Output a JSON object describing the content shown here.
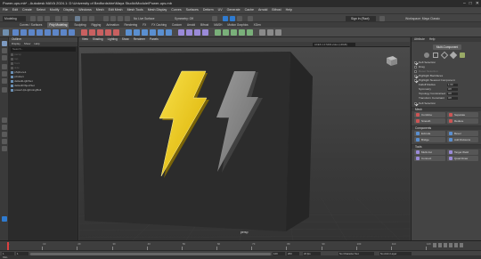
{
  "window": {
    "title": "Power-ups.mb* - Autodesk MAYA 2024.1: D:\\University of Bedfordshire\\Maya Studio\\Module\\Power-ups.mb",
    "min": "–",
    "max": "□",
    "close": "✕"
  },
  "menubar": [
    "File",
    "Edit",
    "Create",
    "Select",
    "Modify",
    "Display",
    "Windows",
    "Mesh",
    "Edit Mesh",
    "Mesh Tools",
    "Mesh Display",
    "Curves",
    "Surfaces",
    "Deform",
    "UV",
    "Generate",
    "Cache",
    "Arnold",
    "Bifrost",
    "Help"
  ],
  "statusline": {
    "workspace_menu": "Modeling",
    "symmetry": "Symmetry: Off",
    "live_surface": "No Live Surface",
    "sign_in": "Sign In (Ravi)",
    "workspace_label": "Workspace: Maya Classic"
  },
  "shelf": {
    "tabs": [
      "Curves / Surfaces",
      "Poly Modeling",
      "Sculpting",
      "Rigging",
      "Animation",
      "Rendering",
      "FX",
      "FX Caching",
      "Custom",
      "Arnold",
      "Bifrost",
      "MASH",
      "Motion Graphics",
      "XGen"
    ],
    "active": "Poly Modeling"
  },
  "outliner": {
    "title": "Outliner",
    "menus": [
      "Display",
      "Show",
      "Help"
    ],
    "search": "Search...",
    "items": [
      {
        "label": "persp",
        "visible": false
      },
      {
        "label": "top",
        "visible": false
      },
      {
        "label": "front",
        "visible": false
      },
      {
        "label": "side",
        "visible": false
      },
      {
        "label": "pSphere1",
        "visible": true
      },
      {
        "label": "pCube1",
        "visible": true
      },
      {
        "label": "defaultLightSet",
        "visible": true
      },
      {
        "label": "defaultObjectSet",
        "visible": true
      },
      {
        "label": "powerUpLightningBolt",
        "visible": true
      }
    ]
  },
  "viewport": {
    "menus": [
      "View",
      "Shading",
      "Lighting",
      "Show",
      "Renderer",
      "Panels"
    ],
    "camera_field": "ACES 1.0 SDR-video (sRGB)",
    "camera_name": "persp"
  },
  "attr": {
    "tabs": [
      "Attribute",
      "Help"
    ],
    "multi_button": "Multi-Component",
    "options": [
      {
        "label": "Soft Selection",
        "checked": true,
        "dim": false
      },
      {
        "label": "Drag",
        "checked": false,
        "dim": false
      },
      {
        "label": "Reset Selection",
        "checked": false,
        "dim": true
      },
      {
        "label": "Highlight Backfaces",
        "checked": true,
        "dim": false
      },
      {
        "label": "Highlight Nearest Component",
        "checked": true,
        "dim": false
      }
    ],
    "falloff": {
      "label": "Falloff Radius",
      "value": "1.00"
    },
    "sym": {
      "label": "Symmetry",
      "value": "Off"
    },
    "topo": {
      "label": "Topology Constrained",
      "value": "Off"
    },
    "trans": {
      "label": "Transform Constraint",
      "value": "Off"
    },
    "soft_btn": "Soft Selection",
    "sections": [
      {
        "title": "Mesh",
        "buttons": [
          {
            "label": "Combine",
            "color": "#c55"
          },
          {
            "label": "Separate",
            "color": "#c55"
          },
          {
            "label": "Smooth",
            "color": "#c55"
          },
          {
            "label": "Reduce",
            "color": "#c55"
          }
        ]
      },
      {
        "title": "Components",
        "buttons": [
          {
            "label": "Extrude",
            "color": "#5a8fd0"
          },
          {
            "label": "Bevel",
            "color": "#5a8fd0"
          },
          {
            "label": "Bridge",
            "color": "#5a8fd0"
          },
          {
            "label": "Add Divisions",
            "color": "#5a8fd0"
          }
        ]
      },
      {
        "title": "Tools",
        "buttons": [
          {
            "label": "Multi-Cut",
            "color": "#9a8ad8"
          },
          {
            "label": "Target Weld",
            "color": "#9a8ad8"
          },
          {
            "label": "Connect",
            "color": "#9a8ad8"
          },
          {
            "label": "Quad Draw",
            "color": "#9a8ad8"
          }
        ]
      }
    ]
  },
  "timeline": {
    "ticks": [
      "1",
      "10",
      "20",
      "30",
      "40",
      "50",
      "60",
      "70",
      "80",
      "90",
      "100",
      "110",
      "120"
    ],
    "current_frame": "1"
  },
  "range": {
    "start": "1",
    "start_inner": "1",
    "end_inner": "120",
    "end": "200",
    "fps": "24 fps",
    "char_set": "No Character Set",
    "anim_layer": "No Anim Layer"
  },
  "cmdline": {
    "label": "MEL"
  }
}
